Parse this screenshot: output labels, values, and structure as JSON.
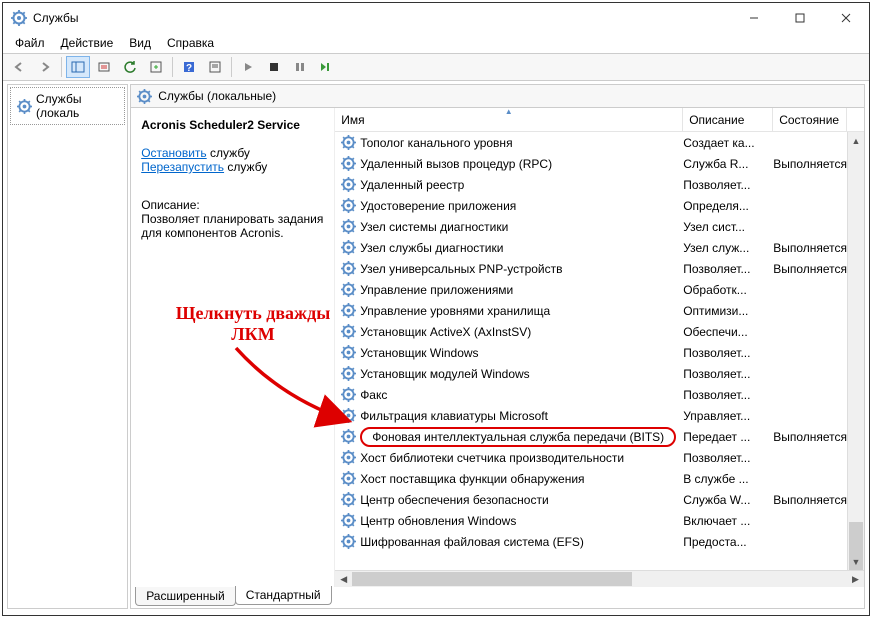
{
  "window": {
    "title": "Службы"
  },
  "menu": {
    "file": "Файл",
    "action": "Действие",
    "view": "Вид",
    "help": "Справка"
  },
  "tree": {
    "root": "Службы (локаль"
  },
  "paneHeader": "Службы (локальные)",
  "detail": {
    "service": "Acronis Scheduler2 Service",
    "stop": "Остановить",
    "stop_suffix": " службу",
    "restart": "Перезапустить",
    "restart_suffix": " службу",
    "descLabel": "Описание:",
    "descText": "Позволяет планировать задания для компонентов Acronis."
  },
  "columns": {
    "name": "Имя",
    "desc": "Описание",
    "state": "Состояние"
  },
  "services": [
    {
      "name": "Тополог канального уровня",
      "desc": "Создает ка...",
      "state": ""
    },
    {
      "name": "Удаленный вызов процедур (RPC)",
      "desc": "Служба R...",
      "state": "Выполняется"
    },
    {
      "name": "Удаленный реестр",
      "desc": "Позволяет...",
      "state": ""
    },
    {
      "name": "Удостоверение приложения",
      "desc": "Определя...",
      "state": ""
    },
    {
      "name": "Узел системы диагностики",
      "desc": "Узел сист...",
      "state": ""
    },
    {
      "name": "Узел службы диагностики",
      "desc": "Узел служ...",
      "state": "Выполняется"
    },
    {
      "name": "Узел универсальных PNP-устройств",
      "desc": "Позволяет...",
      "state": "Выполняется"
    },
    {
      "name": "Управление приложениями",
      "desc": "Обработк...",
      "state": ""
    },
    {
      "name": "Управление уровнями хранилища",
      "desc": "Оптимизи...",
      "state": ""
    },
    {
      "name": "Установщик ActiveX (AxInstSV)",
      "desc": "Обеспечи...",
      "state": ""
    },
    {
      "name": "Установщик Windows",
      "desc": "Позволяет...",
      "state": ""
    },
    {
      "name": "Установщик модулей Windows",
      "desc": "Позволяет...",
      "state": ""
    },
    {
      "name": "Факс",
      "desc": "Позволяет...",
      "state": ""
    },
    {
      "name": "Фильтрация клавиатуры Microsoft",
      "desc": "Управляет...",
      "state": ""
    },
    {
      "name": "Фоновая интеллектуальная служба передачи (BITS)",
      "desc": "Передает ...",
      "state": "Выполняется",
      "hl": true
    },
    {
      "name": "Хост библиотеки счетчика производительности",
      "desc": "Позволяет...",
      "state": ""
    },
    {
      "name": "Хост поставщика функции обнаружения",
      "desc": "В службе ...",
      "state": ""
    },
    {
      "name": "Центр обеспечения безопасности",
      "desc": "Служба W...",
      "state": "Выполняется"
    },
    {
      "name": "Центр обновления Windows",
      "desc": "Включает ...",
      "state": ""
    },
    {
      "name": "Шифрованная файловая система (EFS)",
      "desc": "Предоста...",
      "state": ""
    }
  ],
  "tabs": {
    "ext": "Расширенный",
    "std": "Стандартный"
  },
  "annotation": {
    "line1": "Щелкнуть дважды",
    "line2": "ЛКМ"
  }
}
